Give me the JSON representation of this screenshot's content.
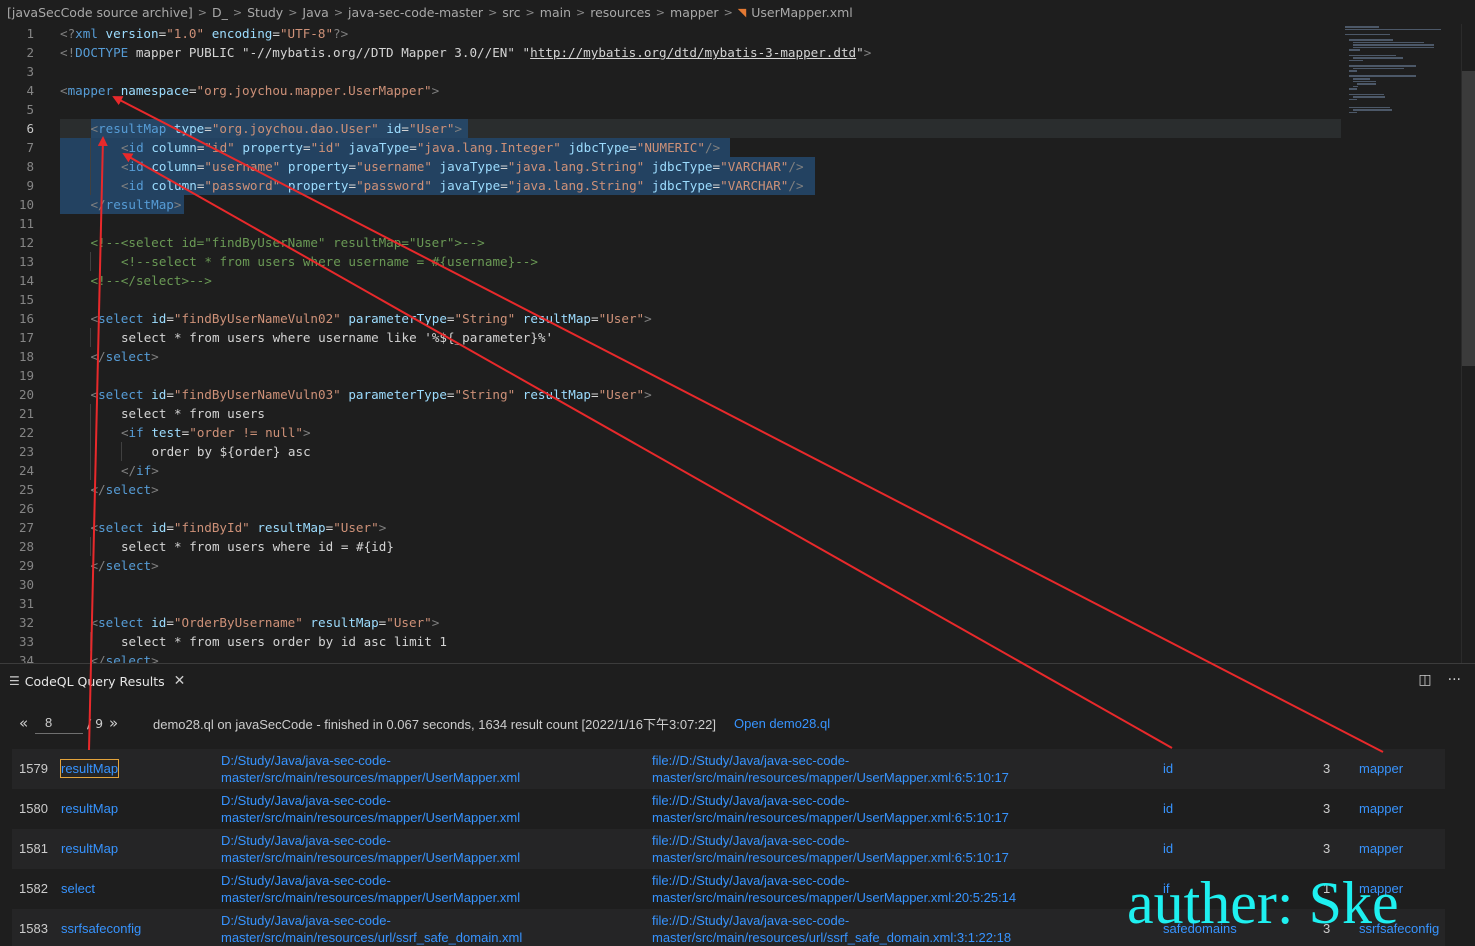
{
  "breadcrumb": {
    "items": [
      "[javaSecCode source archive]",
      "D_",
      "Study",
      "Java",
      "java-sec-code-master",
      "src",
      "main",
      "resources",
      "mapper"
    ],
    "file": "UserMapper.xml"
  },
  "editor": {
    "lines": [
      {
        "n": "1",
        "indent": 0,
        "tokens": [
          [
            "p",
            "<?"
          ],
          [
            "tag",
            "xml"
          ],
          [
            "txt",
            " "
          ],
          [
            "attr",
            "version"
          ],
          [
            "txt",
            "="
          ],
          [
            "str",
            "\"1.0\""
          ],
          [
            "txt",
            " "
          ],
          [
            "attr",
            "encoding"
          ],
          [
            "txt",
            "="
          ],
          [
            "str",
            "\"UTF-8\""
          ],
          [
            "p",
            "?>"
          ]
        ]
      },
      {
        "n": "2",
        "indent": 0,
        "tokens": [
          [
            "p",
            "<!"
          ],
          [
            "tag",
            "DOCTYPE"
          ],
          [
            "txt",
            " mapper PUBLIC \"-//mybatis.org//DTD Mapper 3.0//EN\" \""
          ],
          [
            "url",
            "http://mybatis.org/dtd/mybatis-3-mapper.dtd"
          ],
          [
            "txt",
            "\""
          ],
          [
            "p",
            ">"
          ]
        ]
      },
      {
        "n": "3",
        "indent": 0,
        "tokens": []
      },
      {
        "n": "4",
        "indent": 0,
        "tokens": [
          [
            "p",
            "<"
          ],
          [
            "tag",
            "mapper"
          ],
          [
            "txt",
            " "
          ],
          [
            "attr",
            "namespace"
          ],
          [
            "txt",
            "="
          ],
          [
            "str",
            "\"org.joychou.mapper.UserMapper\""
          ],
          [
            "p",
            ">"
          ]
        ]
      },
      {
        "n": "5",
        "indent": 0,
        "tokens": []
      },
      {
        "n": "6",
        "indent": 1,
        "tokens": [
          [
            "p",
            "<"
          ],
          [
            "tag",
            "resultMap"
          ],
          [
            "txt",
            " "
          ],
          [
            "attr",
            "type"
          ],
          [
            "txt",
            "="
          ],
          [
            "str",
            "\"org.joychou.dao.User\""
          ],
          [
            "txt",
            " "
          ],
          [
            "attr",
            "id"
          ],
          [
            "txt",
            "="
          ],
          [
            "str",
            "\"User\""
          ],
          [
            "p",
            ">"
          ]
        ]
      },
      {
        "n": "7",
        "indent": 2,
        "tokens": [
          [
            "p",
            "<"
          ],
          [
            "tag",
            "id"
          ],
          [
            "txt",
            " "
          ],
          [
            "attr",
            "column"
          ],
          [
            "txt",
            "="
          ],
          [
            "str",
            "\"id\""
          ],
          [
            "txt",
            " "
          ],
          [
            "attr",
            "property"
          ],
          [
            "txt",
            "="
          ],
          [
            "str",
            "\"id\""
          ],
          [
            "txt",
            " "
          ],
          [
            "attr",
            "javaType"
          ],
          [
            "txt",
            "="
          ],
          [
            "str",
            "\"java.lang.Integer\""
          ],
          [
            "txt",
            " "
          ],
          [
            "attr",
            "jdbcType"
          ],
          [
            "txt",
            "="
          ],
          [
            "str",
            "\"NUMERIC\""
          ],
          [
            "p",
            "/>"
          ]
        ]
      },
      {
        "n": "8",
        "indent": 2,
        "tokens": [
          [
            "p",
            "<"
          ],
          [
            "tag",
            "id"
          ],
          [
            "txt",
            " "
          ],
          [
            "attr",
            "column"
          ],
          [
            "txt",
            "="
          ],
          [
            "str",
            "\"username\""
          ],
          [
            "txt",
            " "
          ],
          [
            "attr",
            "property"
          ],
          [
            "txt",
            "="
          ],
          [
            "str",
            "\"username\""
          ],
          [
            "txt",
            " "
          ],
          [
            "attr",
            "javaType"
          ],
          [
            "txt",
            "="
          ],
          [
            "str",
            "\"java.lang.String\""
          ],
          [
            "txt",
            " "
          ],
          [
            "attr",
            "jdbcType"
          ],
          [
            "txt",
            "="
          ],
          [
            "str",
            "\"VARCHAR\""
          ],
          [
            "p",
            "/>"
          ]
        ]
      },
      {
        "n": "9",
        "indent": 2,
        "tokens": [
          [
            "p",
            "<"
          ],
          [
            "tag",
            "id"
          ],
          [
            "txt",
            " "
          ],
          [
            "attr",
            "column"
          ],
          [
            "txt",
            "="
          ],
          [
            "str",
            "\"password\""
          ],
          [
            "txt",
            " "
          ],
          [
            "attr",
            "property"
          ],
          [
            "txt",
            "="
          ],
          [
            "str",
            "\"password\""
          ],
          [
            "txt",
            " "
          ],
          [
            "attr",
            "javaType"
          ],
          [
            "txt",
            "="
          ],
          [
            "str",
            "\"java.lang.String\""
          ],
          [
            "txt",
            " "
          ],
          [
            "attr",
            "jdbcType"
          ],
          [
            "txt",
            "="
          ],
          [
            "str",
            "\"VARCHAR\""
          ],
          [
            "p",
            "/>"
          ]
        ]
      },
      {
        "n": "10",
        "indent": 1,
        "tokens": [
          [
            "p",
            "</"
          ],
          [
            "tag",
            "resultMap"
          ],
          [
            "p",
            ">"
          ]
        ]
      },
      {
        "n": "11",
        "indent": 0,
        "tokens": []
      },
      {
        "n": "12",
        "indent": 1,
        "tokens": [
          [
            "com",
            "<!--<select id=\"findByUserName\" resultMap=\"User\">-->"
          ]
        ]
      },
      {
        "n": "13",
        "indent": 2,
        "tokens": [
          [
            "com",
            "<!--select * from users where username = #{username}-->"
          ]
        ]
      },
      {
        "n": "14",
        "indent": 1,
        "tokens": [
          [
            "com",
            "<!--</select>-->"
          ]
        ]
      },
      {
        "n": "15",
        "indent": 0,
        "tokens": []
      },
      {
        "n": "16",
        "indent": 1,
        "tokens": [
          [
            "p",
            "<"
          ],
          [
            "tag",
            "select"
          ],
          [
            "txt",
            " "
          ],
          [
            "attr",
            "id"
          ],
          [
            "txt",
            "="
          ],
          [
            "str",
            "\"findByUserNameVuln02\""
          ],
          [
            "txt",
            " "
          ],
          [
            "attr",
            "parameterType"
          ],
          [
            "txt",
            "="
          ],
          [
            "str",
            "\"String\""
          ],
          [
            "txt",
            " "
          ],
          [
            "attr",
            "resultMap"
          ],
          [
            "txt",
            "="
          ],
          [
            "str",
            "\"User\""
          ],
          [
            "p",
            ">"
          ]
        ]
      },
      {
        "n": "17",
        "indent": 2,
        "tokens": [
          [
            "txt",
            "select * from users where username like '%${_parameter}%'"
          ]
        ]
      },
      {
        "n": "18",
        "indent": 1,
        "tokens": [
          [
            "p",
            "</"
          ],
          [
            "tag",
            "select"
          ],
          [
            "p",
            ">"
          ]
        ]
      },
      {
        "n": "19",
        "indent": 0,
        "tokens": []
      },
      {
        "n": "20",
        "indent": 1,
        "tokens": [
          [
            "p",
            "<"
          ],
          [
            "tag",
            "select"
          ],
          [
            "txt",
            " "
          ],
          [
            "attr",
            "id"
          ],
          [
            "txt",
            "="
          ],
          [
            "str",
            "\"findByUserNameVuln03\""
          ],
          [
            "txt",
            " "
          ],
          [
            "attr",
            "parameterType"
          ],
          [
            "txt",
            "="
          ],
          [
            "str",
            "\"String\""
          ],
          [
            "txt",
            " "
          ],
          [
            "attr",
            "resultMap"
          ],
          [
            "txt",
            "="
          ],
          [
            "str",
            "\"User\""
          ],
          [
            "p",
            ">"
          ]
        ]
      },
      {
        "n": "21",
        "indent": 2,
        "tokens": [
          [
            "txt",
            "select * from users"
          ]
        ]
      },
      {
        "n": "22",
        "indent": 2,
        "tokens": [
          [
            "p",
            "<"
          ],
          [
            "tag",
            "if"
          ],
          [
            "txt",
            " "
          ],
          [
            "attr",
            "test"
          ],
          [
            "txt",
            "="
          ],
          [
            "str",
            "\"order != null\""
          ],
          [
            "p",
            ">"
          ]
        ]
      },
      {
        "n": "23",
        "indent": 3,
        "tokens": [
          [
            "txt",
            "order by ${order} asc"
          ]
        ]
      },
      {
        "n": "24",
        "indent": 2,
        "tokens": [
          [
            "p",
            "</"
          ],
          [
            "tag",
            "if"
          ],
          [
            "p",
            ">"
          ]
        ]
      },
      {
        "n": "25",
        "indent": 1,
        "tokens": [
          [
            "p",
            "</"
          ],
          [
            "tag",
            "select"
          ],
          [
            "p",
            ">"
          ]
        ]
      },
      {
        "n": "26",
        "indent": 0,
        "tokens": []
      },
      {
        "n": "27",
        "indent": 1,
        "tokens": [
          [
            "p",
            "<"
          ],
          [
            "tag",
            "select"
          ],
          [
            "txt",
            " "
          ],
          [
            "attr",
            "id"
          ],
          [
            "txt",
            "="
          ],
          [
            "str",
            "\"findById\""
          ],
          [
            "txt",
            " "
          ],
          [
            "attr",
            "resultMap"
          ],
          [
            "txt",
            "="
          ],
          [
            "str",
            "\"User\""
          ],
          [
            "p",
            ">"
          ]
        ]
      },
      {
        "n": "28",
        "indent": 2,
        "tokens": [
          [
            "txt",
            "select * from users where id = #{id}"
          ]
        ]
      },
      {
        "n": "29",
        "indent": 1,
        "tokens": [
          [
            "p",
            "</"
          ],
          [
            "tag",
            "select"
          ],
          [
            "p",
            ">"
          ]
        ]
      },
      {
        "n": "30",
        "indent": 0,
        "tokens": []
      },
      {
        "n": "31",
        "indent": 0,
        "tokens": []
      },
      {
        "n": "32",
        "indent": 1,
        "tokens": [
          [
            "p",
            "<"
          ],
          [
            "tag",
            "select"
          ],
          [
            "txt",
            " "
          ],
          [
            "attr",
            "id"
          ],
          [
            "txt",
            "="
          ],
          [
            "str",
            "\"OrderByUsername\""
          ],
          [
            "txt",
            " "
          ],
          [
            "attr",
            "resultMap"
          ],
          [
            "txt",
            "="
          ],
          [
            "str",
            "\"User\""
          ],
          [
            "p",
            ">"
          ]
        ]
      },
      {
        "n": "33",
        "indent": 2,
        "tokens": [
          [
            "txt",
            "select * from users order by id asc limit 1"
          ]
        ]
      },
      {
        "n": "34",
        "indent": 1,
        "tokens": [
          [
            "p",
            "</"
          ],
          [
            "tag",
            "select"
          ],
          [
            "p",
            ">"
          ]
        ]
      }
    ]
  },
  "panel": {
    "tab_title": "CodeQL Query Results",
    "prev": "«",
    "next": "»",
    "page_current": "8",
    "page_total": "/ 9",
    "query_info": "demo28.ql on javaSecCode - finished in 0.067 seconds, 1634 result count [2022/1/16下午3:07:22]",
    "open_link": "Open demo28.ql"
  },
  "results": [
    {
      "num": "1579",
      "name": "resultMap",
      "path": [
        "D:/Study/Java/java-sec-code-",
        "master/src/main/resources/mapper/UserMapper.xml"
      ],
      "loc": [
        "file://D:/Study/Java/java-sec-code-",
        "master/src/main/resources/mapper/UserMapper.xml:6:5:10:17"
      ],
      "elem": "id",
      "count": "3",
      "parent": "mapper"
    },
    {
      "num": "1580",
      "name": "resultMap",
      "path": [
        "D:/Study/Java/java-sec-code-",
        "master/src/main/resources/mapper/UserMapper.xml"
      ],
      "loc": [
        "file://D:/Study/Java/java-sec-code-",
        "master/src/main/resources/mapper/UserMapper.xml:6:5:10:17"
      ],
      "elem": "id",
      "count": "3",
      "parent": "mapper"
    },
    {
      "num": "1581",
      "name": "resultMap",
      "path": [
        "D:/Study/Java/java-sec-code-",
        "master/src/main/resources/mapper/UserMapper.xml"
      ],
      "loc": [
        "file://D:/Study/Java/java-sec-code-",
        "master/src/main/resources/mapper/UserMapper.xml:6:5:10:17"
      ],
      "elem": "id",
      "count": "3",
      "parent": "mapper"
    },
    {
      "num": "1582",
      "name": "select",
      "path": [
        "D:/Study/Java/java-sec-code-",
        "master/src/main/resources/mapper/UserMapper.xml"
      ],
      "loc": [
        "file://D:/Study/Java/java-sec-code-",
        "master/src/main/resources/mapper/UserMapper.xml:20:5:25:14"
      ],
      "elem": "if",
      "count": "1",
      "parent": "mapper"
    },
    {
      "num": "1583",
      "name": "ssrfsafeconfig",
      "path": [
        "D:/Study/Java/java-sec-code-",
        "master/src/main/resources/url/ssrf_safe_domain.xml"
      ],
      "loc": [
        "file://D:/Study/Java/java-sec-code-",
        "master/src/main/resources/url/ssrf_safe_domain.xml:3:1:22:18"
      ],
      "elem": "safedomains",
      "count": "3",
      "parent": "ssrfsafeconfig"
    }
  ],
  "watermark": "auther: Ske",
  "colors": {
    "accent_link": "#3794ff",
    "arrow": "#e8292b",
    "watermark": "#1ef0f0",
    "selection": "#264f78"
  }
}
